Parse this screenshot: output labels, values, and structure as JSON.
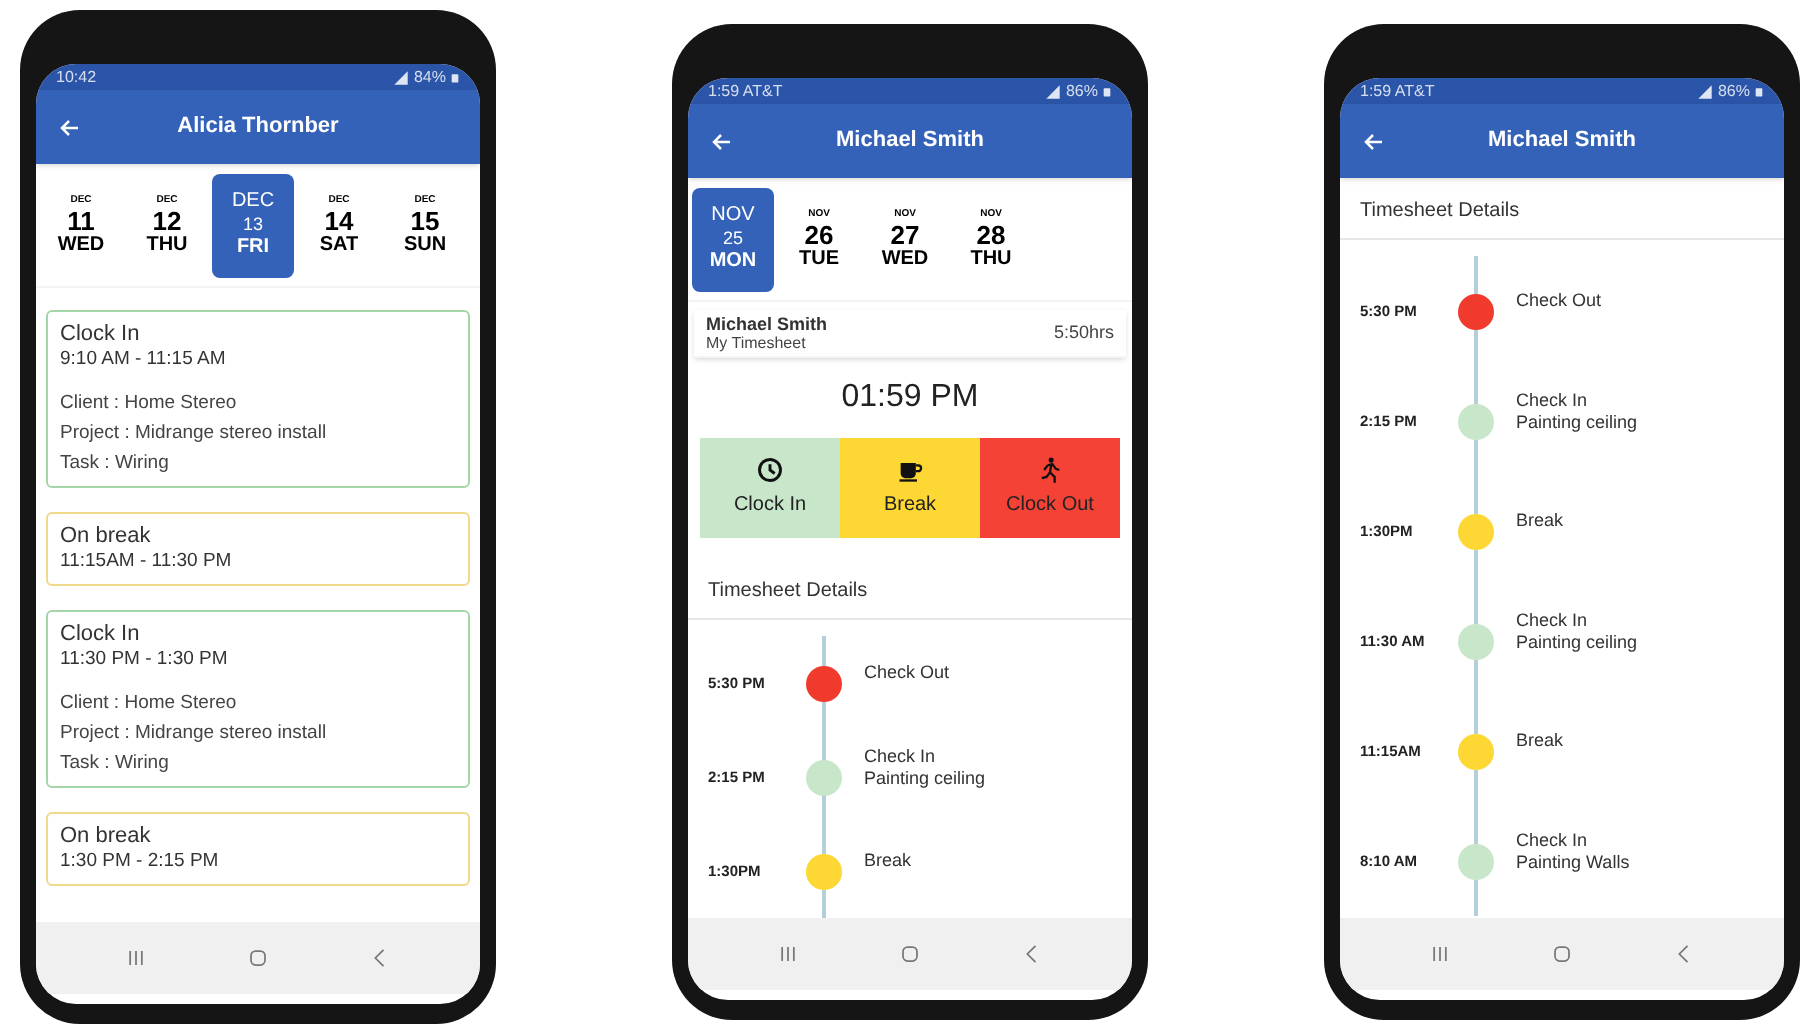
{
  "phones": [
    {
      "status_bar": {
        "time": "10:42",
        "battery": "84%"
      },
      "app_bar": {
        "title": "Alicia Thornber"
      },
      "date_strip": [
        {
          "month": "DEC",
          "day": "11",
          "weekday": "WED",
          "selected": false
        },
        {
          "month": "DEC",
          "day": "12",
          "weekday": "THU",
          "selected": false
        },
        {
          "month": "DEC",
          "day": "13",
          "weekday": "FRI",
          "selected": true
        },
        {
          "month": "DEC",
          "day": "14",
          "weekday": "SAT",
          "selected": false
        },
        {
          "month": "DEC",
          "day": "15",
          "weekday": "SUN",
          "selected": false
        }
      ],
      "entries": [
        {
          "kind": "work",
          "title": "Clock In",
          "time_range": "9:10 AM - 11:15 AM",
          "details": [
            "Client : Home Stereo",
            "Project : Midrange stereo install",
            "Task : Wiring"
          ]
        },
        {
          "kind": "break",
          "title": "On break",
          "time_range": "11:15AM - 11:30 PM"
        },
        {
          "kind": "work",
          "title": "Clock In",
          "time_range": "11:30 PM - 1:30 PM",
          "details": [
            "Client : Home Stereo",
            "Project : Midrange stereo install",
            "Task : Wiring"
          ]
        },
        {
          "kind": "break",
          "title": "On break",
          "time_range": "1:30 PM - 2:15 PM"
        }
      ]
    },
    {
      "status_bar": {
        "time": "1:59 AT&T",
        "battery": "86%"
      },
      "app_bar": {
        "title": "Michael Smith"
      },
      "date_strip": [
        {
          "month": "NOV",
          "day": "25",
          "weekday": "MON",
          "selected": true
        },
        {
          "month": "NOV",
          "day": "26",
          "weekday": "TUE",
          "selected": false
        },
        {
          "month": "NOV",
          "day": "27",
          "weekday": "WED",
          "selected": false
        },
        {
          "month": "NOV",
          "day": "28",
          "weekday": "THU",
          "selected": false
        }
      ],
      "summary": {
        "name": "Michael Smith",
        "subtitle": "My Timesheet",
        "hours": "5:50hrs"
      },
      "clock": "01:59 PM",
      "actions": [
        {
          "kind": "clock_in",
          "label": "Clock In"
        },
        {
          "kind": "break",
          "label": "Break"
        },
        {
          "kind": "clock_out",
          "label": "Clock Out"
        }
      ],
      "details_title": "Timesheet Details",
      "timeline": [
        {
          "kind": "check_out",
          "time": "5:30 PM",
          "title": "Check Out"
        },
        {
          "kind": "check_in",
          "time": "2:15 PM",
          "title": "Check In",
          "subtitle": "Painting ceiling"
        },
        {
          "kind": "break",
          "time": "1:30PM",
          "title": "Break"
        }
      ]
    },
    {
      "status_bar": {
        "time": "1:59 AT&T",
        "battery": "86%"
      },
      "app_bar": {
        "title": "Michael Smith"
      },
      "details_title": "Timesheet Details",
      "timeline": [
        {
          "kind": "check_out",
          "time": "5:30 PM",
          "title": "Check Out"
        },
        {
          "kind": "check_in",
          "time": "2:15 PM",
          "title": "Check In",
          "subtitle": "Painting ceiling"
        },
        {
          "kind": "break",
          "time": "1:30PM",
          "title": "Break"
        },
        {
          "kind": "check_in",
          "time": "11:30 AM",
          "title": "Check In",
          "subtitle": "Painting ceiling"
        },
        {
          "kind": "break",
          "time": "11:15AM",
          "title": "Break"
        },
        {
          "kind": "check_in",
          "time": "8:10 AM",
          "title": "Check In",
          "subtitle": "Painting Walls"
        }
      ]
    }
  ]
}
